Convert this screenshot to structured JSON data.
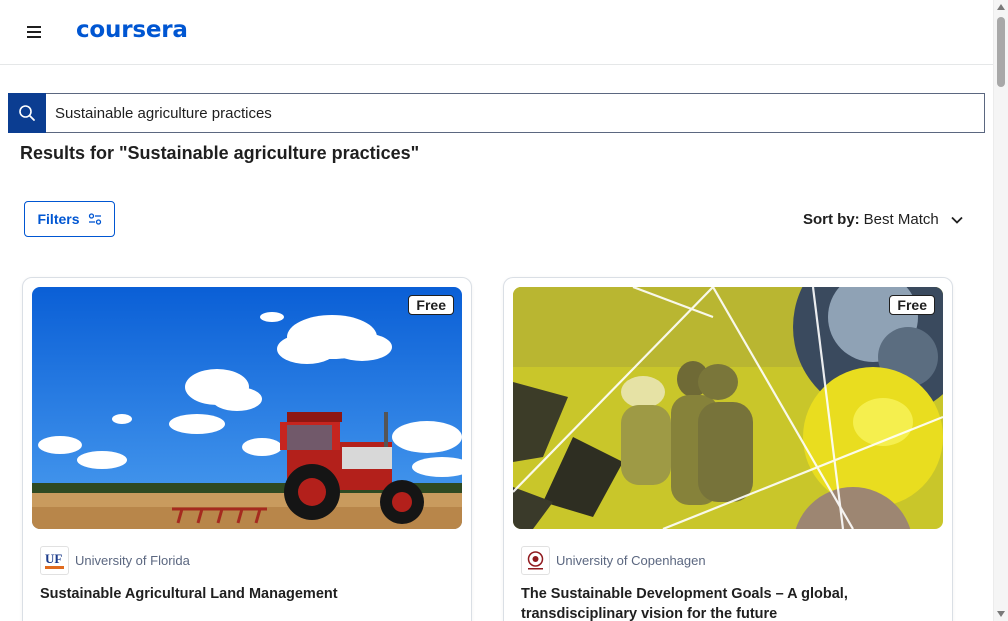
{
  "header": {
    "logo_text": "coursera",
    "menu_icon": "hamburger-menu-icon"
  },
  "search": {
    "value": "Sustainable agriculture practices",
    "icon": "search-icon"
  },
  "results": {
    "title": "Results for \"Sustainable agriculture practices\""
  },
  "toolbar": {
    "filters_label": "Filters",
    "filters_icon": "sliders-icon",
    "sort_label": "Sort by:",
    "sort_value": "Best Match",
    "sort_icon": "chevron-down-icon"
  },
  "cards": [
    {
      "badge": "Free",
      "partner": "University of Florida",
      "partner_logo_text": "UF",
      "title": "Sustainable Agricultural Land Management",
      "image": "tractor-in-field-image"
    },
    {
      "badge": "Free",
      "partner": "University of Copenhagen",
      "title": "The Sustainable Development Goals – A global, transdisciplinary vision for the future",
      "image": "sdg-collage-image"
    }
  ],
  "colors": {
    "brand_blue": "#0056d2",
    "search_button": "#0b3d91",
    "text_primary": "#1f1f1f",
    "text_secondary": "#5b6780"
  }
}
